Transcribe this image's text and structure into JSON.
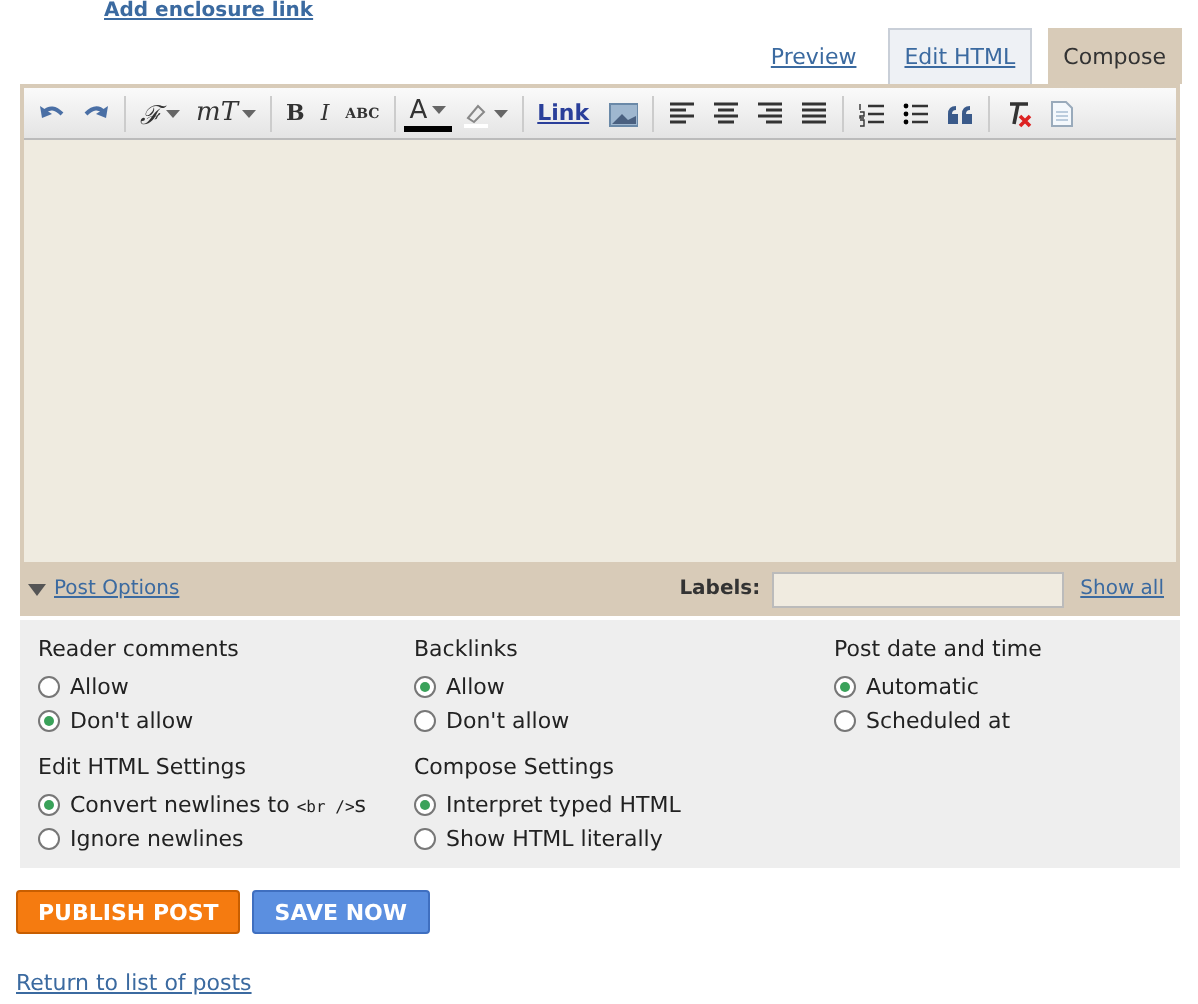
{
  "top_link": "Add enclosure link",
  "preview_link": "Preview",
  "tabs": [
    {
      "label": "Edit HTML",
      "selected": false
    },
    {
      "label": "Compose",
      "selected": true
    }
  ],
  "toolbar": [
    {
      "kind": "undo"
    },
    {
      "kind": "redo"
    },
    {
      "kind": "sep"
    },
    {
      "kind": "menu",
      "label": "ℱ"
    },
    {
      "kind": "menu",
      "label": "тT"
    },
    {
      "kind": "sep"
    },
    {
      "kind": "bold",
      "label": "B"
    },
    {
      "kind": "italic",
      "label": "I"
    },
    {
      "kind": "small",
      "label": "ABC"
    },
    {
      "kind": "sep"
    },
    {
      "kind": "color",
      "label": "A"
    },
    {
      "kind": "highlight"
    },
    {
      "kind": "sep"
    },
    {
      "kind": "link",
      "label": "Link"
    },
    {
      "kind": "image"
    },
    {
      "kind": "sep"
    },
    {
      "kind": "align-left"
    },
    {
      "kind": "align-center"
    },
    {
      "kind": "align-right"
    },
    {
      "kind": "justify"
    },
    {
      "kind": "sep"
    },
    {
      "kind": "numbered"
    },
    {
      "kind": "bulleted"
    },
    {
      "kind": "quote"
    },
    {
      "kind": "sep"
    },
    {
      "kind": "clear"
    },
    {
      "kind": "page"
    }
  ],
  "post_options": {
    "label": "Post Options",
    "expanded": true
  },
  "labels": {
    "label": "Labels:",
    "show_all": "Show all"
  },
  "option_groups": [
    {
      "title": "Reader comments",
      "options": [
        {
          "label": "Allow",
          "selected": false
        },
        {
          "label": "Don't allow",
          "selected": true
        }
      ]
    },
    {
      "title": "Backlinks",
      "options": [
        {
          "label": "Allow",
          "selected": true
        },
        {
          "label": "Don't allow",
          "selected": false
        }
      ]
    },
    {
      "title": "Post date and time",
      "options": [
        {
          "label": "Automatic",
          "selected": true
        },
        {
          "label": "Scheduled at",
          "selected": false
        }
      ]
    },
    {
      "title": "Edit HTML Settings",
      "options": [
        {
          "label": "Convert newlines to ",
          "code": "<br />",
          "suffix": "s",
          "selected": true
        },
        {
          "label": "Ignore newlines",
          "selected": false
        }
      ]
    },
    {
      "title": "Compose Settings",
      "options": [
        {
          "label": "Interpret typed HTML",
          "selected": true
        },
        {
          "label": "Show HTML literally",
          "selected": false
        }
      ]
    }
  ],
  "buttons": [
    {
      "label": "PUBLISH POST",
      "kind": "primary"
    },
    {
      "label": "SAVE NOW",
      "kind": "secondary"
    }
  ],
  "return_link": "Return to list of posts"
}
